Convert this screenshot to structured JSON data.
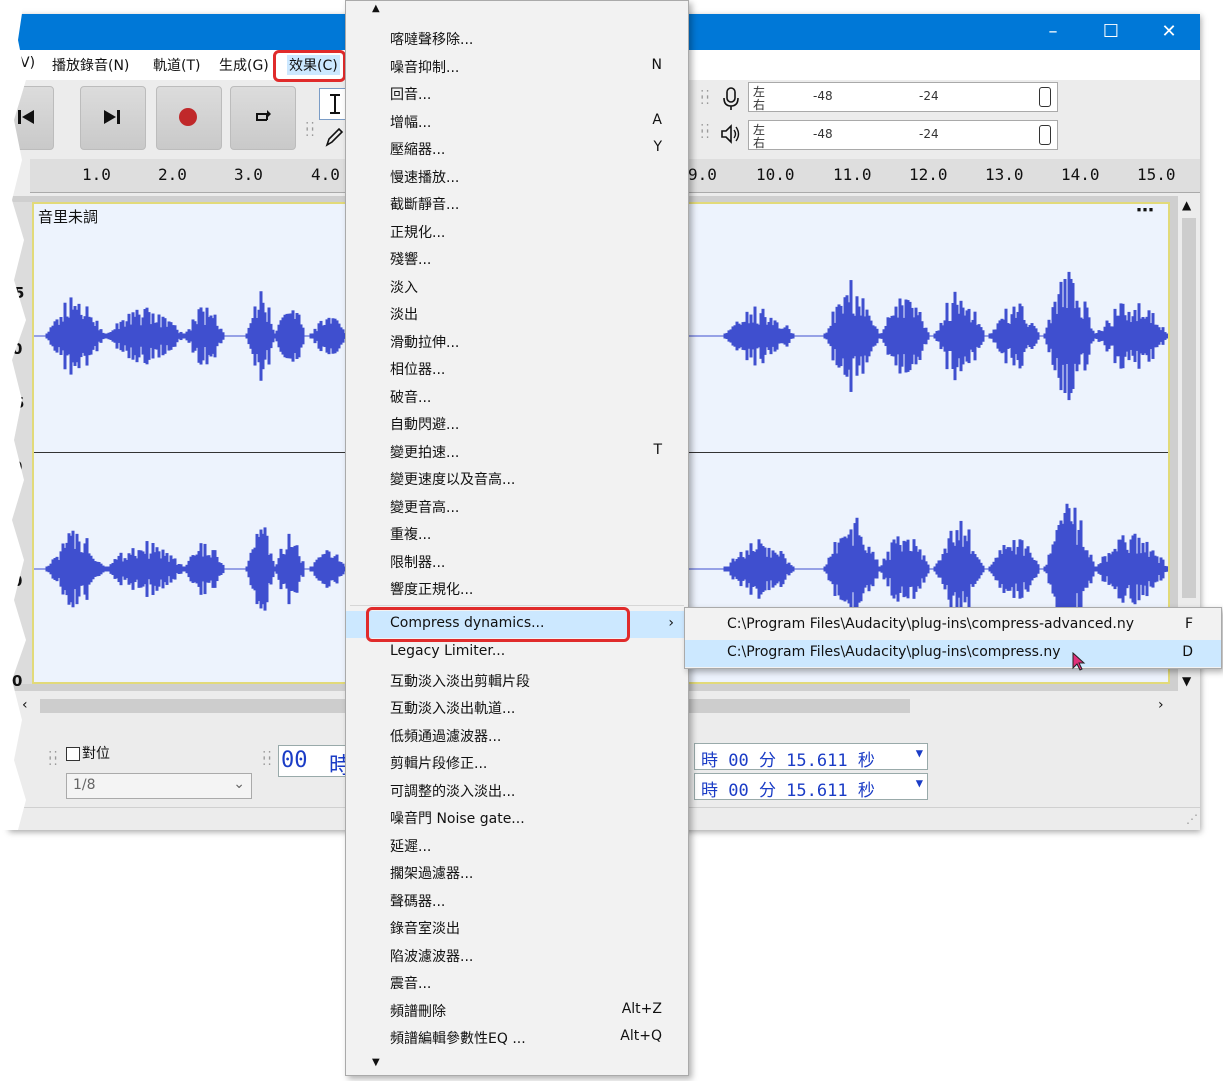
{
  "menubar": {
    "items": [
      {
        "label": "V)"
      },
      {
        "label": "播放錄音(N)"
      },
      {
        "label": "軌道(T)"
      },
      {
        "label": "生成(G)"
      },
      {
        "label": "效果(C)"
      }
    ]
  },
  "meters": {
    "record": {
      "ch_left": "左",
      "ch_right": "右",
      "tick1": "-48",
      "tick2": "-24"
    },
    "play": {
      "ch_left": "左",
      "ch_right": "右",
      "tick1": "-48",
      "tick2": "-24"
    }
  },
  "ruler": {
    "labels": [
      "1.0",
      "2.0",
      "3.0",
      "4.0",
      "9.0",
      "10.0",
      "11.0",
      "12.0",
      "13.0",
      "14.0",
      "15.0"
    ]
  },
  "track": {
    "name": "音里未調",
    "menu_icon": "more-icon",
    "scale_labels": [
      "0",
      "5",
      "0",
      "5",
      "0",
      "0",
      "0"
    ]
  },
  "bottom": {
    "snap_label": "對位",
    "snap_value": "1/8",
    "sel_start_prefix": "00",
    "sel_start_unit": "時",
    "time1": "時 00 分 15.611 秒",
    "time2": "時 00 分 15.611 秒"
  },
  "menu": {
    "items": [
      {
        "label": "喀噠聲移除...",
        "acc": ""
      },
      {
        "label": "噪音抑制...",
        "acc": "N"
      },
      {
        "label": "回音...",
        "acc": ""
      },
      {
        "label": "增幅...",
        "acc": "A"
      },
      {
        "label": "壓縮器...",
        "acc": "Y"
      },
      {
        "label": "慢速播放...",
        "acc": ""
      },
      {
        "label": "截斷靜音...",
        "acc": ""
      },
      {
        "label": "正規化...",
        "acc": ""
      },
      {
        "label": "殘響...",
        "acc": ""
      },
      {
        "label": "淡入",
        "acc": ""
      },
      {
        "label": "淡出",
        "acc": ""
      },
      {
        "label": "滑動拉伸...",
        "acc": ""
      },
      {
        "label": "相位器...",
        "acc": ""
      },
      {
        "label": "破音...",
        "acc": ""
      },
      {
        "label": "自動閃避...",
        "acc": ""
      },
      {
        "label": "變更拍速...",
        "acc": "T"
      },
      {
        "label": "變更速度以及音高...",
        "acc": ""
      },
      {
        "label": "變更音高...",
        "acc": ""
      },
      {
        "label": "重複...",
        "acc": ""
      },
      {
        "label": "限制器...",
        "acc": ""
      },
      {
        "label": "響度正規化...",
        "acc": ""
      }
    ],
    "compress": {
      "label": "Compress dynamics...",
      "arrow": "›"
    },
    "items2": [
      {
        "label": "Legacy Limiter...",
        "acc": ""
      },
      {
        "label": "互動淡入淡出剪輯片段",
        "acc": ""
      },
      {
        "label": "互動淡入淡出軌道...",
        "acc": ""
      },
      {
        "label": "低頻通過濾波器...",
        "acc": ""
      },
      {
        "label": "剪輯片段修正...",
        "acc": ""
      },
      {
        "label": "可調整的淡入淡出...",
        "acc": ""
      },
      {
        "label": "噪音門 Noise gate...",
        "acc": ""
      },
      {
        "label": "延遲...",
        "acc": ""
      },
      {
        "label": "擱架過濾器...",
        "acc": ""
      },
      {
        "label": "聲碼器...",
        "acc": ""
      },
      {
        "label": "錄音室淡出",
        "acc": ""
      },
      {
        "label": "陷波濾波器...",
        "acc": ""
      },
      {
        "label": "震音...",
        "acc": ""
      },
      {
        "label": "頻譜刪除",
        "acc": "Alt+Z"
      },
      {
        "label": "頻譜編輯參數性EQ ...",
        "acc": "Alt+Q"
      }
    ]
  },
  "submenu": {
    "items": [
      {
        "label": "C:\\Program Files\\Audacity\\plug-ins\\compress-advanced.ny",
        "acc": "F"
      },
      {
        "label": "C:\\Program Files\\Audacity\\plug-ins\\compress.ny",
        "acc": "D"
      }
    ]
  },
  "colors": {
    "titlebar": "#0078d7",
    "waveform": "#3f4fcf",
    "highlight": "#cce8ff",
    "callout": "#e02b2b"
  }
}
